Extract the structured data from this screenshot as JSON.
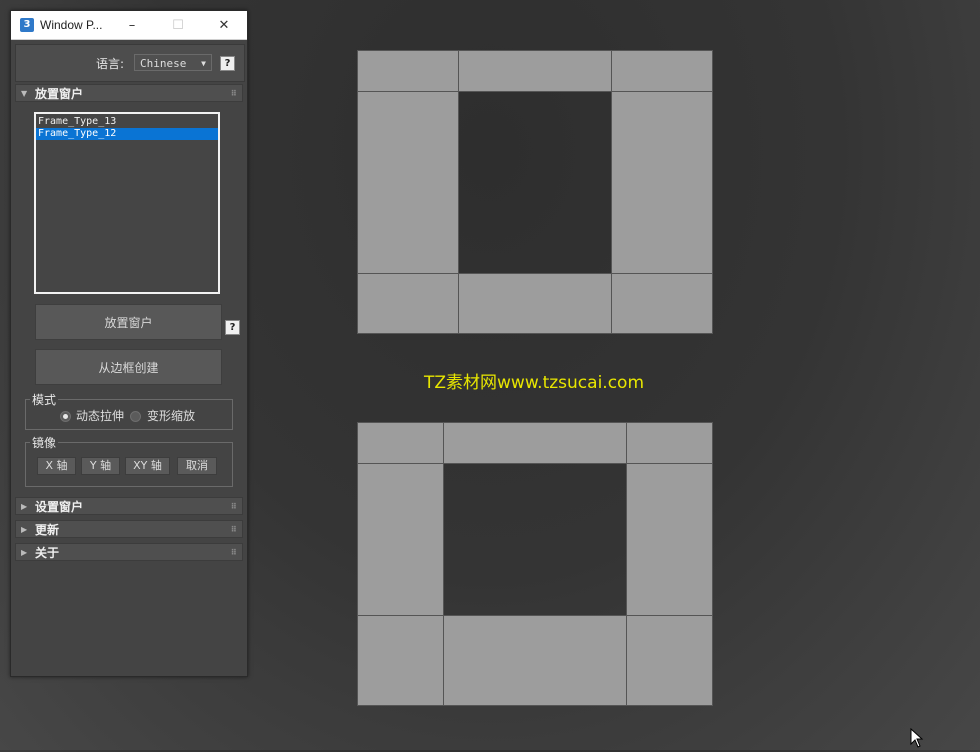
{
  "window": {
    "title": "Window P...",
    "app_icon": "3",
    "minimize_icon": "–",
    "maximize_icon": "☐",
    "close_icon": "✕"
  },
  "language": {
    "label": "语言:",
    "selected": "Chinese",
    "help": "?"
  },
  "rollouts": {
    "place": {
      "label": "放置窗户",
      "expanded": true
    },
    "settings": {
      "label": "设置窗户",
      "expanded": false
    },
    "update": {
      "label": "更新",
      "expanded": false
    },
    "about": {
      "label": "关于",
      "expanded": false
    }
  },
  "frame_list": {
    "items": [
      "Frame_Type_13",
      "Frame_Type_12"
    ],
    "selected_index": 1
  },
  "buttons": {
    "place_window": "放置窗户",
    "place_help": "?",
    "create_from_border": "从边框创建"
  },
  "mode": {
    "title": "模式",
    "options": [
      "动态拉伸",
      "变形缩放"
    ],
    "selected_index": 0
  },
  "mirror": {
    "title": "镜像",
    "buttons": [
      "X 轴",
      "Y 轴",
      "XY 轴",
      "取消"
    ]
  },
  "viewport": {
    "watermark": "TZ素材网www.tzsucai.com",
    "watermark_color": "#e8e600",
    "frame_color": "#9d9d9d"
  }
}
